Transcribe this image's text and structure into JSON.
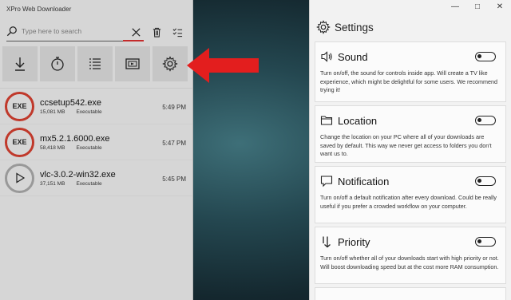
{
  "left_app": {
    "title": "XPro Web Downloader",
    "search": {
      "placeholder": "Type here to search"
    },
    "downloads": [
      {
        "icon_label": "EXE",
        "name": "ccsetup542.exe",
        "size": "15,081 MB",
        "type": "Executable",
        "time": "5:49 PM",
        "icon": "exe"
      },
      {
        "icon_label": "EXE",
        "name": "mx5.2.1.6000.exe",
        "size": "58,418 MB",
        "type": "Executable",
        "time": "5:47 PM",
        "icon": "exe"
      },
      {
        "icon_label": "",
        "name": "vlc-3.0.2-win32.exe",
        "size": "37,151 MB",
        "type": "Executable",
        "time": "5:45 PM",
        "icon": "play"
      }
    ]
  },
  "right_app": {
    "title": "Settings",
    "window_controls": [
      "—",
      "□",
      "✕"
    ],
    "cards": [
      {
        "title": "Sound",
        "icon": "speaker-icon",
        "desc": "Turn on/off, the sound for controls inside app. Will create a TV like experience, which might be delightful for some users. We recommend trying it!"
      },
      {
        "title": "Location",
        "icon": "folder-icon",
        "desc": "Change the location on your PC where all of your downloads are saved by default. This way we never get access to folders you don't want us to."
      },
      {
        "title": "Notification",
        "icon": "chat-bubble-icon",
        "desc": "Turn on/off a default notification after every download. Could be really useful if you prefer a crowded workflow on your computer."
      },
      {
        "title": "Priority",
        "icon": "priority-icon",
        "desc": "Turn on/off whether all of your downloads start with high priority or not. Will boost downloading speed but at the cost more RAM consumption."
      }
    ]
  },
  "colors": {
    "accent_red": "#c0392b",
    "arrow_red": "#e31e1e"
  }
}
